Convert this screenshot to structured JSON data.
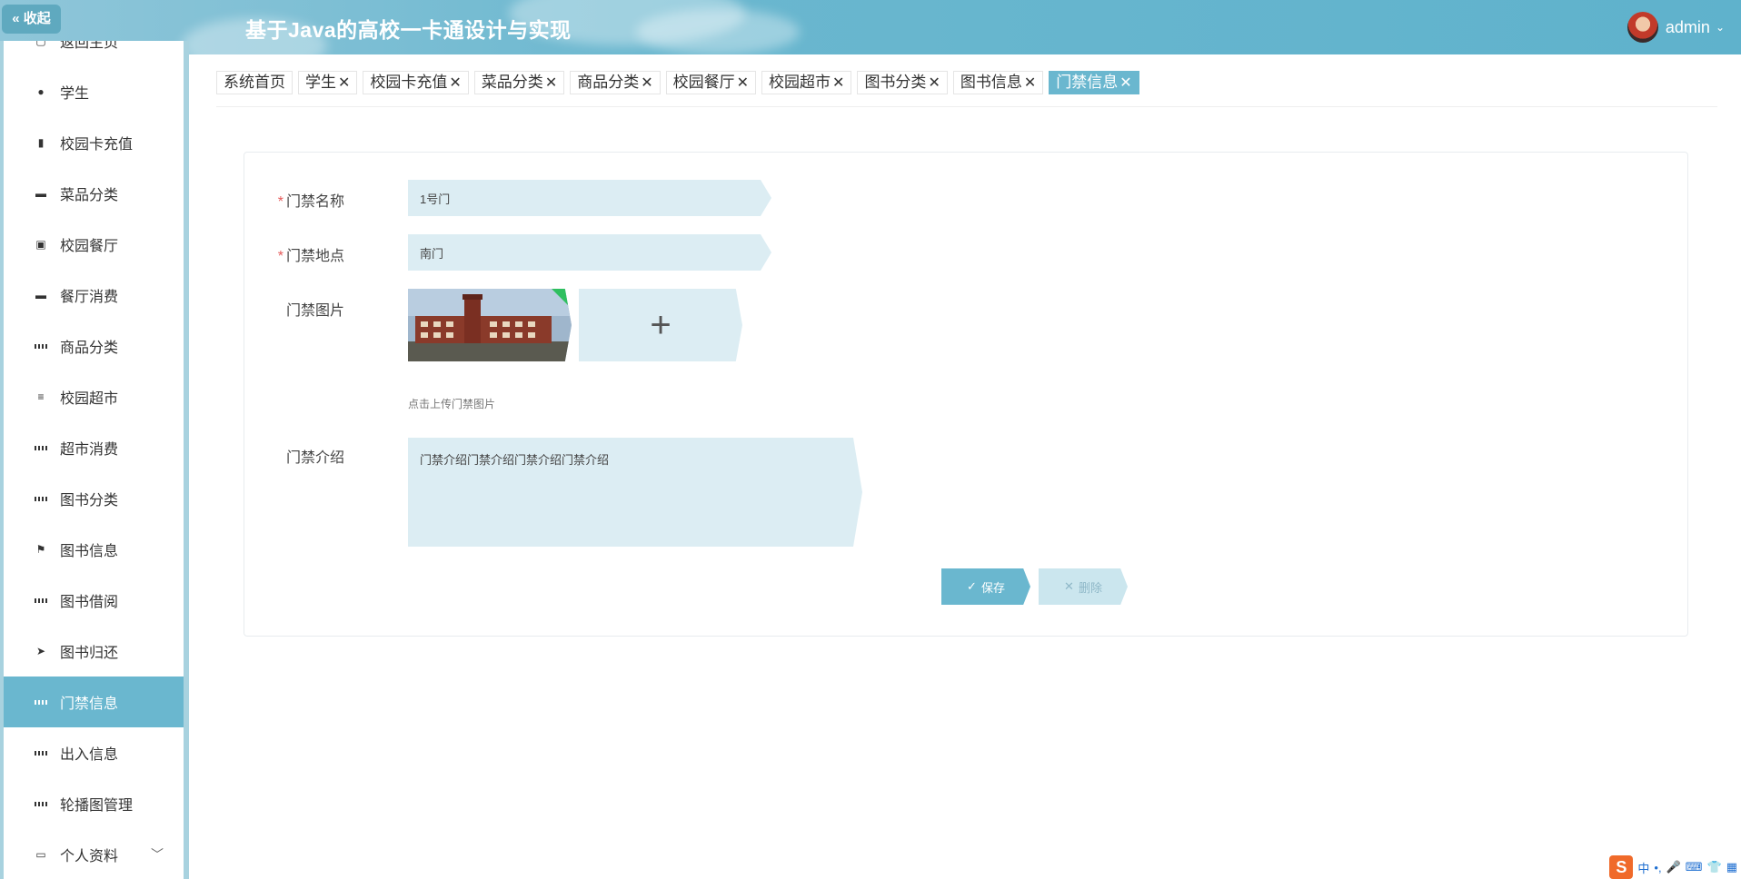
{
  "header": {
    "collapse_label": "« 收起",
    "title": "基于Java的高校一卡通设计与实现",
    "user": "admin"
  },
  "sidebar": {
    "items": [
      {
        "label": "返回主页",
        "icon": "home-icon"
      },
      {
        "label": "学生",
        "icon": "user-icon"
      },
      {
        "label": "校园卡充值",
        "icon": "brush-icon"
      },
      {
        "label": "菜品分类",
        "icon": "chat-icon"
      },
      {
        "label": "校园餐厅",
        "icon": "clipboard-icon"
      },
      {
        "label": "餐厅消费",
        "icon": "monitor-icon"
      },
      {
        "label": "商品分类",
        "icon": "grid-icon"
      },
      {
        "label": "校园超市",
        "icon": "list-icon"
      },
      {
        "label": "超市消费",
        "icon": "grid-icon"
      },
      {
        "label": "图书分类",
        "icon": "grid-icon"
      },
      {
        "label": "图书信息",
        "icon": "flag-icon"
      },
      {
        "label": "图书借阅",
        "icon": "grid-icon"
      },
      {
        "label": "图书归还",
        "icon": "send-icon"
      },
      {
        "label": "门禁信息",
        "icon": "grid-icon",
        "active": true
      },
      {
        "label": "出入信息",
        "icon": "grid-icon"
      },
      {
        "label": "轮播图管理",
        "icon": "grid-icon"
      },
      {
        "label": "个人资料",
        "icon": "card-icon"
      }
    ]
  },
  "tabs": [
    {
      "label": "系统首页",
      "closable": false
    },
    {
      "label": "学生",
      "closable": true
    },
    {
      "label": "校园卡充值",
      "closable": true
    },
    {
      "label": "菜品分类",
      "closable": true
    },
    {
      "label": "商品分类",
      "closable": true
    },
    {
      "label": "校园餐厅",
      "closable": true
    },
    {
      "label": "校园超市",
      "closable": true
    },
    {
      "label": "图书分类",
      "closable": true
    },
    {
      "label": "图书信息",
      "closable": true
    },
    {
      "label": "门禁信息",
      "closable": true,
      "active": true
    }
  ],
  "form": {
    "name_label": "门禁名称",
    "name_value": "1号门",
    "location_label": "门禁地点",
    "location_value": "南门",
    "image_label": "门禁图片",
    "image_hint": "点击上传门禁图片",
    "intro_label": "门禁介绍",
    "intro_value": "门禁介绍门禁介绍门禁介绍门禁介绍",
    "save_label": "保存",
    "delete_label": "删除"
  },
  "tray": {
    "lang": "中"
  },
  "colors": {
    "accent": "#6ab7cf",
    "field_bg": "#dcedf3",
    "required": "#e65a5a"
  }
}
